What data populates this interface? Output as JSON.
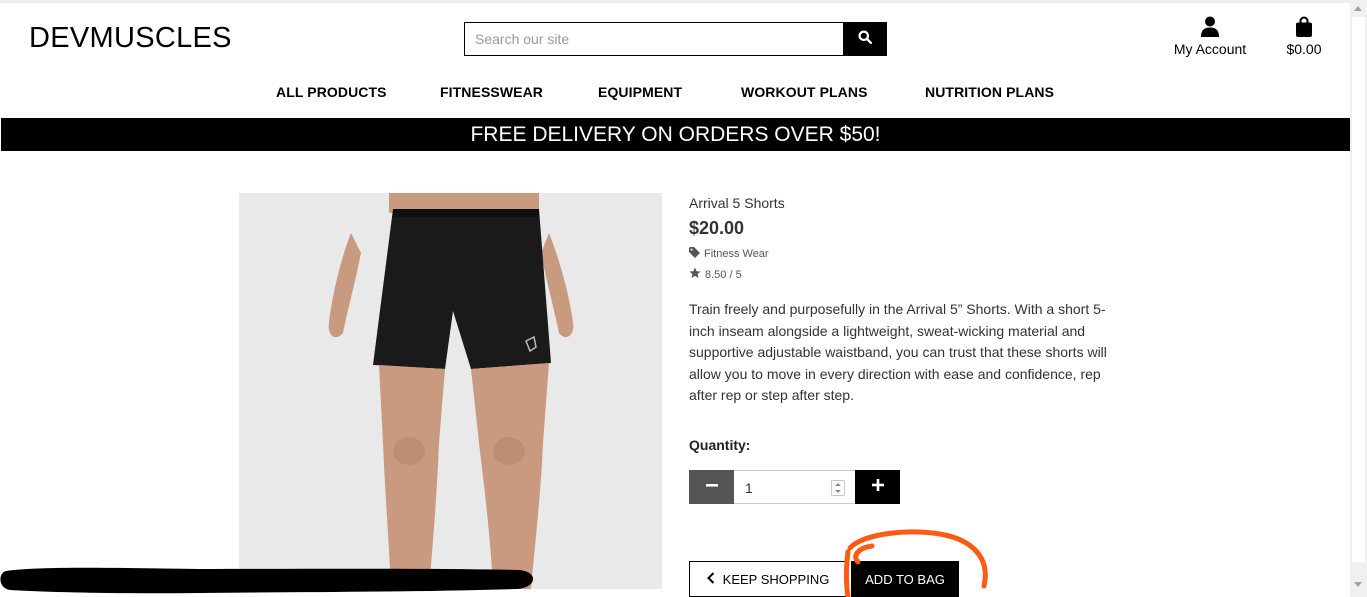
{
  "header": {
    "logo": "DEVMUSCLES",
    "search": {
      "placeholder": "Search our site"
    },
    "account": {
      "label": "My Account"
    },
    "bag": {
      "total": "$0.00"
    }
  },
  "nav": {
    "items": [
      {
        "label": "ALL PRODUCTS"
      },
      {
        "label": "FITNESSWEAR"
      },
      {
        "label": "EQUIPMENT"
      },
      {
        "label": "WORKOUT PLANS"
      },
      {
        "label": "NUTRITION PLANS"
      }
    ]
  },
  "banner": {
    "text": "FREE DELIVERY ON ORDERS OVER $50!"
  },
  "product": {
    "name": "Arrival 5 Shorts",
    "price": "$20.00",
    "category": "Fitness Wear",
    "rating": "8.50 / 5",
    "description": "Train freely and purposefully in the Arrival 5” Shorts. With a short 5-inch inseam alongside a lightweight, sweat-wicking material and supportive adjustable waistband, you can trust that these shorts will allow you to move in every direction with ease and confidence, rep after rep or step after step."
  },
  "quantity": {
    "label": "Quantity:",
    "value": "1"
  },
  "actions": {
    "keep_shopping": "KEEP SHOPPING",
    "add_to_bag": "ADD TO BAG"
  },
  "colors": {
    "accent": "#000000",
    "minus_button": "#555555",
    "annotation_circle": "#ff5a14",
    "redaction": "#000000"
  },
  "icons": [
    "search-icon",
    "user-icon",
    "shopping-bag-icon",
    "tag-icon",
    "star-icon",
    "minus-icon",
    "plus-icon",
    "chevron-left-icon"
  ]
}
